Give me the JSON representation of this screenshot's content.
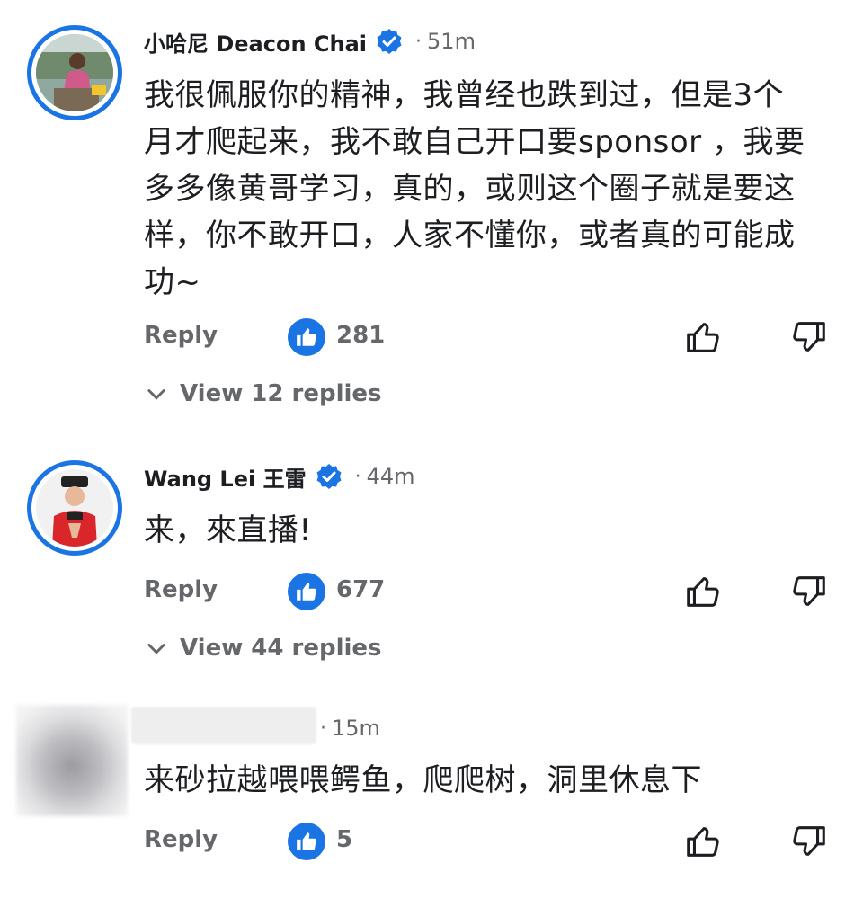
{
  "comments": [
    {
      "author": "小哈尼 Deacon Chai",
      "verified": true,
      "dot": "·",
      "time": "51m",
      "text_lines": [
        "我很佩服你的精神，我曾经也跌到过，但是3个",
        "月才爬起来，我不敢自己开口要sponsor ，我要",
        "多多像黄哥学习，真的，或则这个圈子就是要这",
        "样，你不敢开口，人家不懂你，或者真的可能成",
        "功~"
      ],
      "reply_label": "Reply",
      "like_count": "281",
      "view_replies": "View 12 replies"
    },
    {
      "author": "Wang Lei 王雷",
      "verified": true,
      "dot": "·",
      "time": "44m",
      "text_lines": [
        "来，來直播!"
      ],
      "reply_label": "Reply",
      "like_count": "677",
      "view_replies": "View 44 replies"
    },
    {
      "author": "",
      "verified": false,
      "dot": "·",
      "time": "15m",
      "text_lines": [
        "来砂拉越喂喂鳄鱼，爬爬树，洞里休息下"
      ],
      "reply_label": "Reply",
      "like_count": "5"
    }
  ],
  "colors": {
    "accent": "#1b74e4",
    "secondary_text": "#65676b",
    "primary_text": "#1c1e21"
  },
  "icons": [
    "verified-badge-icon",
    "like-reaction-icon",
    "thumbs-up-icon",
    "thumbs-down-icon",
    "chevron-down-icon"
  ]
}
